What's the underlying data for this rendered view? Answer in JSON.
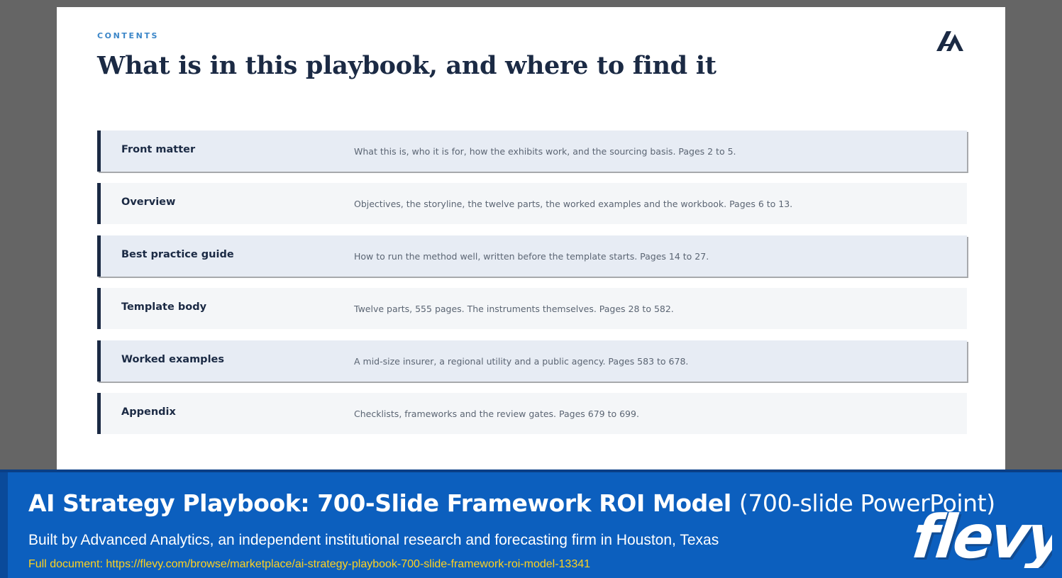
{
  "slide": {
    "eyebrow": "CONTENTS",
    "title": "What is in this playbook, and where to find it",
    "logo_icon": "advanced-analytics-logo",
    "rows": [
      {
        "name": "Front matter",
        "desc": "What this is, who it is for, how the exhibits work, and the sourcing basis. Pages 2 to 5."
      },
      {
        "name": "Overview",
        "desc": "Objectives, the storyline, the twelve parts, the worked examples and the workbook. Pages 6 to 13."
      },
      {
        "name": "Best practice guide",
        "desc": "How to run the method well, written before the template starts. Pages 14 to 27."
      },
      {
        "name": "Template body",
        "desc": "Twelve parts, 555 pages. The instruments themselves. Pages 28 to 582."
      },
      {
        "name": "Worked examples",
        "desc": "A mid-size insurer, a regional utility and a public agency. Pages 583 to 678."
      },
      {
        "name": "Appendix",
        "desc": "Checklists, frameworks and the review gates. Pages 679 to 699."
      }
    ]
  },
  "banner": {
    "title": "AI Strategy Playbook: 700-Slide Framework ROI Model",
    "title_suffix": "(700-slide PowerPoint)",
    "subtitle": "Built by Advanced Analytics, an independent institutional research and forecasting firm in Houston, Texas",
    "link": "Full document: https://flevy.com/browse/marketplace/ai-strategy-playbook-700-slide-framework-roi-model-13341",
    "brand": "flevy"
  },
  "colors": {
    "navy": "#1b2a44",
    "accent_blue": "#3b86c8",
    "banner_blue": "#0c5fbe",
    "link_yellow": "#ffd21f",
    "row_shaded": "#e7ecf4",
    "row_plain": "#f4f6f8"
  }
}
